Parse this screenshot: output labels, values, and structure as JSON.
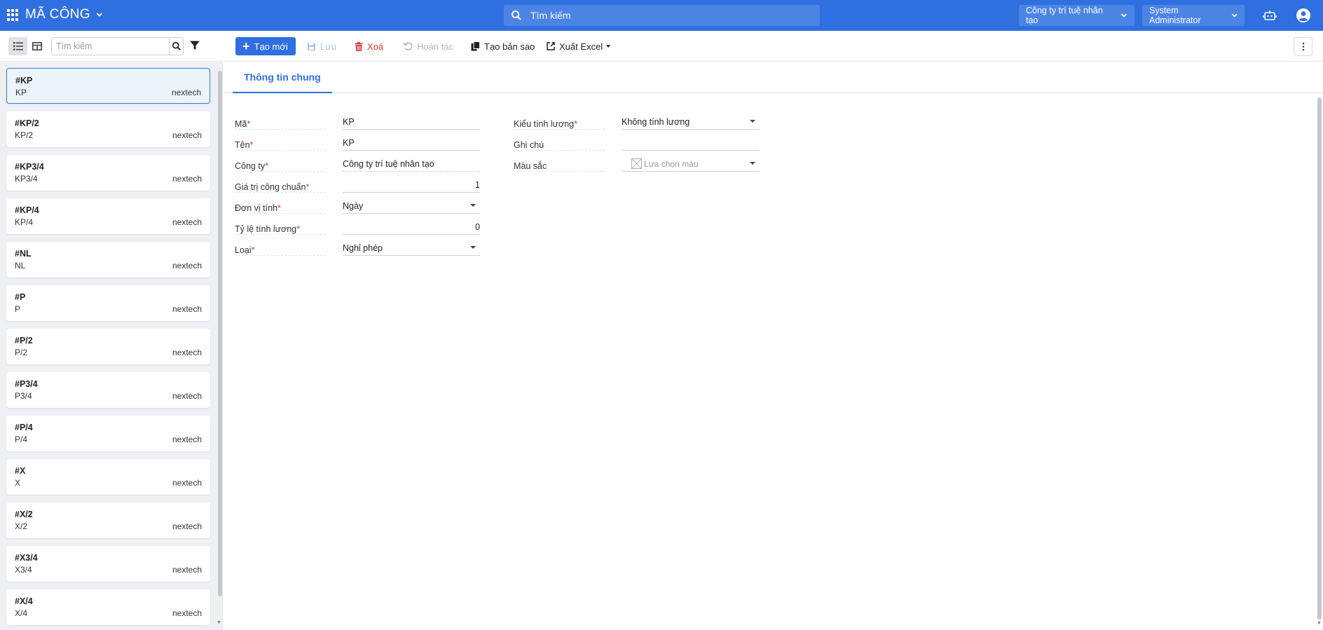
{
  "app": {
    "title": "MÃ CÔNG"
  },
  "topbar": {
    "search_placeholder": "Tìm kiếm",
    "company": "Công ty trí tuệ nhân tạo",
    "user": "System Administrator"
  },
  "toolbar": {
    "list_search_placeholder": "Tìm kiếm",
    "new_label": "Tạo mới",
    "save_label": "Lưu",
    "delete_label": "Xoá",
    "undo_label": "Hoàn tác",
    "copy_label": "Tạo bản sao",
    "export_label": "Xuất Excel"
  },
  "list": {
    "items": [
      {
        "code": "#KP",
        "name": "KP",
        "tenant": "nextech",
        "selected": true
      },
      {
        "code": "#KP/2",
        "name": "KP/2",
        "tenant": "nextech"
      },
      {
        "code": "#KP3/4",
        "name": "KP3/4",
        "tenant": "nextech"
      },
      {
        "code": "#KP/4",
        "name": "KP/4",
        "tenant": "nextech"
      },
      {
        "code": "#NL",
        "name": "NL",
        "tenant": "nextech"
      },
      {
        "code": "#P",
        "name": "P",
        "tenant": "nextech"
      },
      {
        "code": "#P/2",
        "name": "P/2",
        "tenant": "nextech"
      },
      {
        "code": "#P3/4",
        "name": "P3/4",
        "tenant": "nextech"
      },
      {
        "code": "#P/4",
        "name": "P/4",
        "tenant": "nextech"
      },
      {
        "code": "#X",
        "name": "X",
        "tenant": "nextech"
      },
      {
        "code": "#X/2",
        "name": "X/2",
        "tenant": "nextech"
      },
      {
        "code": "#X3/4",
        "name": "X3/4",
        "tenant": "nextech"
      },
      {
        "code": "#X/4",
        "name": "X/4",
        "tenant": "nextech"
      }
    ]
  },
  "form": {
    "tab_label": "Thông tin chung",
    "required_mark": "*",
    "fields": {
      "ma": {
        "label": "Mã",
        "value": "KP"
      },
      "ten": {
        "label": "Tên",
        "value": "KP"
      },
      "cong_ty": {
        "label": "Công ty",
        "value": "Công ty trí tuệ nhân tạo"
      },
      "gia_tri": {
        "label": "Giá trị công chuẩn",
        "value": "1"
      },
      "don_vi": {
        "label": "Đơn vị tính",
        "value": "Ngày"
      },
      "ty_le": {
        "label": "Tỷ lệ tính lương",
        "value": "0"
      },
      "loai": {
        "label": "Loại",
        "value": "Nghỉ phép"
      },
      "kieu": {
        "label": "Kiểu tính lương",
        "value": "Không tính lương"
      },
      "ghi_chu": {
        "label": "Ghi chú",
        "value": ""
      },
      "mau_sac": {
        "label": "Màu sắc",
        "placeholder": "Lựa chọn màu"
      }
    }
  },
  "colors": {
    "primary": "#2f6fe0",
    "danger": "#d93a3a",
    "required": "#e03131"
  }
}
